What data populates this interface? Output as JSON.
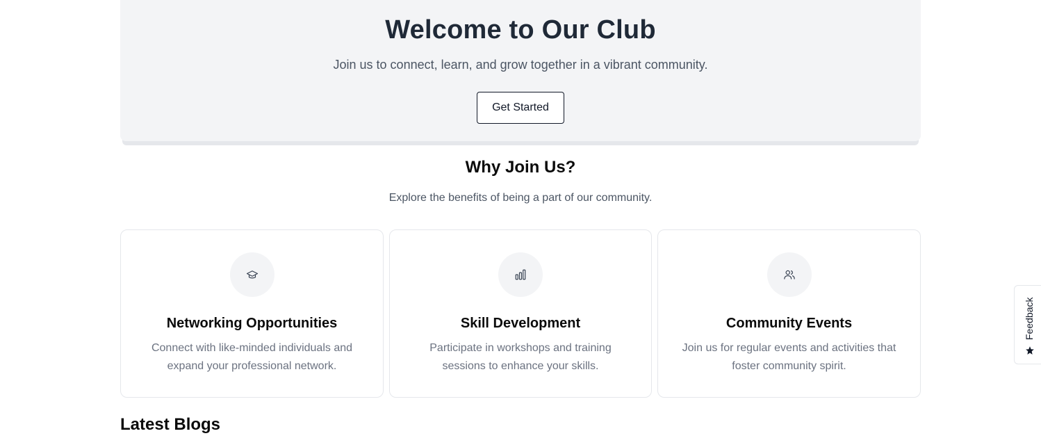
{
  "hero": {
    "title": "Welcome to Our Club",
    "subtitle": "Join us to connect, learn, and grow together in a vibrant community.",
    "cta_label": "Get Started"
  },
  "why": {
    "title": "Why Join Us?",
    "subtitle": "Explore the benefits of being a part of our community."
  },
  "features": [
    {
      "icon": "graduation-cap-icon",
      "title": "Networking Opportunities",
      "description": "Connect with like-minded individuals and expand your professional network."
    },
    {
      "icon": "bar-chart-icon",
      "title": "Skill Development",
      "description": "Participate in workshops and training sessions to enhance your skills."
    },
    {
      "icon": "users-icon",
      "title": "Community Events",
      "description": "Join us for regular events and activities that foster community spirit."
    }
  ],
  "blogs": {
    "title": "Latest Blogs"
  },
  "feedback": {
    "label": "Feedback",
    "icon": "star-icon"
  },
  "colors": {
    "hero_bg": "#f3f4f6",
    "text_dark": "#1f2937",
    "text_muted": "#6b7280",
    "border": "#e5e7eb"
  }
}
